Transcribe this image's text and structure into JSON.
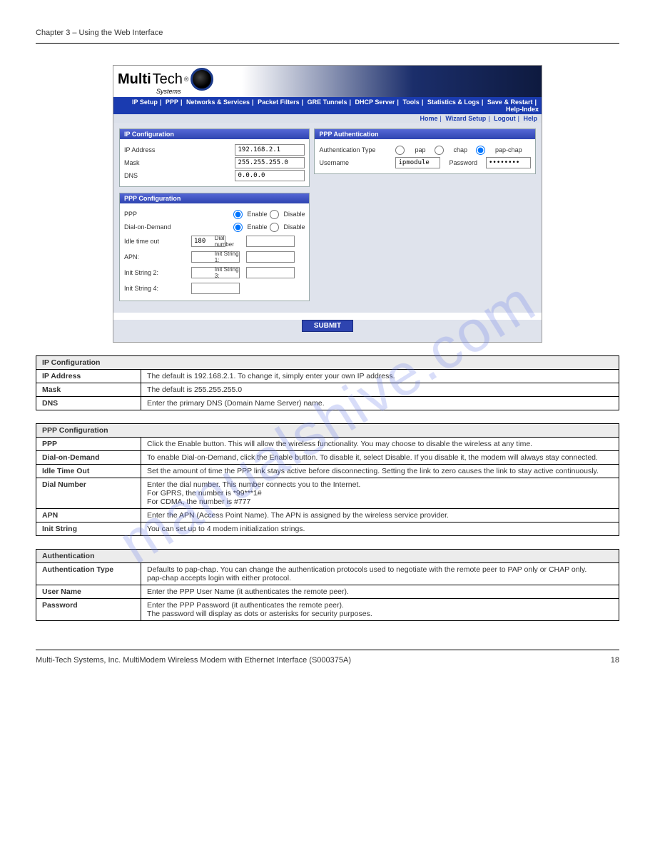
{
  "pageHeader": {
    "left": "Chapter 3 – Using the Web Interface",
    "right": ""
  },
  "pageFooter": {
    "left": "Multi-Tech Systems, Inc. MultiModem Wireless Modem with Ethernet Interface (S000375A)",
    "right": "18"
  },
  "nav": [
    "IP Setup",
    "PPP",
    "Networks & Services",
    "Packet Filters",
    "GRE Tunnels",
    "DHCP Server",
    "Tools",
    "Statistics & Logs",
    "Save & Restart",
    "Help-Index"
  ],
  "subnav": [
    "Home",
    "Wizard Setup",
    "Logout",
    "Help"
  ],
  "ipconfig": {
    "title": "IP Configuration",
    "ip_label": "IP Address",
    "ip_value": "192.168.2.1",
    "mask_label": "Mask",
    "mask_value": "255.255.255.0",
    "dns_label": "DNS",
    "dns_value": "0.0.0.0"
  },
  "pppconf": {
    "title": "PPP Configuration",
    "ppp_label": "PPP",
    "ena": "Enable",
    "dis": "Disable",
    "dod_label": "Dial-on-Demand",
    "idle_label": "Idle time out",
    "idle_value": "180",
    "dial_label": "Dial number",
    "apn_label": "APN:",
    "is1_label": "Init String 1:",
    "is2_label": "Init String 2:",
    "is3_label": "Init String 3:",
    "is4_label": "Init String 4:"
  },
  "auth": {
    "title": "PPP Authentication",
    "type_label": "Authentication Type",
    "opt1": "pap",
    "opt2": "chap",
    "opt3": "pap-chap",
    "user_label": "Username",
    "user_value": "ipmodule",
    "pass_label": "Password",
    "pass_value": "********"
  },
  "submit_label": "SUBMIT",
  "t1": {
    "hdr": "IP Configuration",
    "rows": [
      [
        "IP Address",
        "The default is 192.168.2.1. To change it, simply enter your own IP address."
      ],
      [
        "Mask",
        "The default is 255.255.255.0"
      ],
      [
        "DNS",
        "Enter the primary DNS (Domain Name Server) name."
      ]
    ]
  },
  "t2": {
    "hdr": "PPP Configuration",
    "rows": [
      [
        "PPP",
        "Click the Enable button. This will allow the wireless functionality. You may choose to disable the wireless at any time."
      ],
      [
        "Dial-on-Demand",
        "To enable Dial-on-Demand, click the Enable button. To disable it, select Disable. If you disable it, the modem will always stay connected."
      ],
      [
        "Idle Time Out",
        "Set the amount of time the PPP link stays active before disconnecting. Setting the link to zero causes the link to stay active continuously."
      ],
      [
        "Dial Number",
        "Enter the dial number. This number connects you to the Internet.\nFor GPRS, the number is *99***1#\nFor CDMA, the number is #777"
      ],
      [
        "APN",
        "Enter the APN (Access Point Name). The APN is assigned by the wireless service provider."
      ],
      [
        "Init String",
        "You can set up to 4 modem initialization strings."
      ]
    ]
  },
  "t3": {
    "hdr": "Authentication",
    "rows": [
      [
        "Authentication Type",
        "Defaults to pap-chap. You can change the authentication protocols used to negotiate with the remote peer to PAP only or CHAP only.\npap-chap accepts login with either protocol."
      ],
      [
        "User Name",
        "Enter the PPP User Name (it authenticates the remote peer)."
      ],
      [
        "Password",
        "Enter the PPP Password (it authenticates the remote peer).\nThe password will display as dots or asterisks for security purposes."
      ]
    ]
  },
  "watermark": "manualshive.com"
}
